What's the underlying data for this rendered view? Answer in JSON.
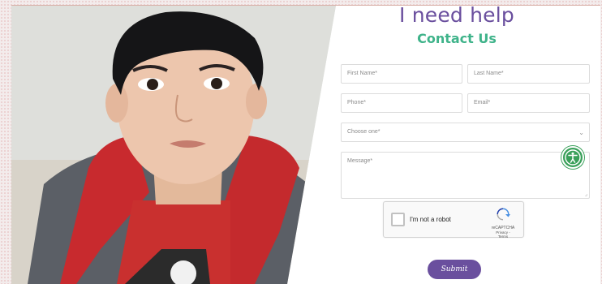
{
  "header": {
    "title": "I need help",
    "subtitle": "Contact Us"
  },
  "form": {
    "first_name": "First Name*",
    "last_name": "Last Name*",
    "phone": "Phone*",
    "email": "Email*",
    "choose": "Choose one*",
    "message": "Message*",
    "submit_label": "Submit"
  },
  "recaptcha": {
    "label": "I'm not a robot",
    "brand": "reCAPTCHA",
    "links": "Privacy - Terms"
  },
  "icons": {
    "accessibility": "accessibility-icon",
    "recaptcha": "recaptcha-logo-icon",
    "select_arrow": "chevron-down-icon"
  },
  "colors": {
    "title": "#6a4f9e",
    "subtitle": "#3fb38a",
    "submit_bg": "#6a4f9e",
    "accessibility_bg": "#3aa05a"
  }
}
